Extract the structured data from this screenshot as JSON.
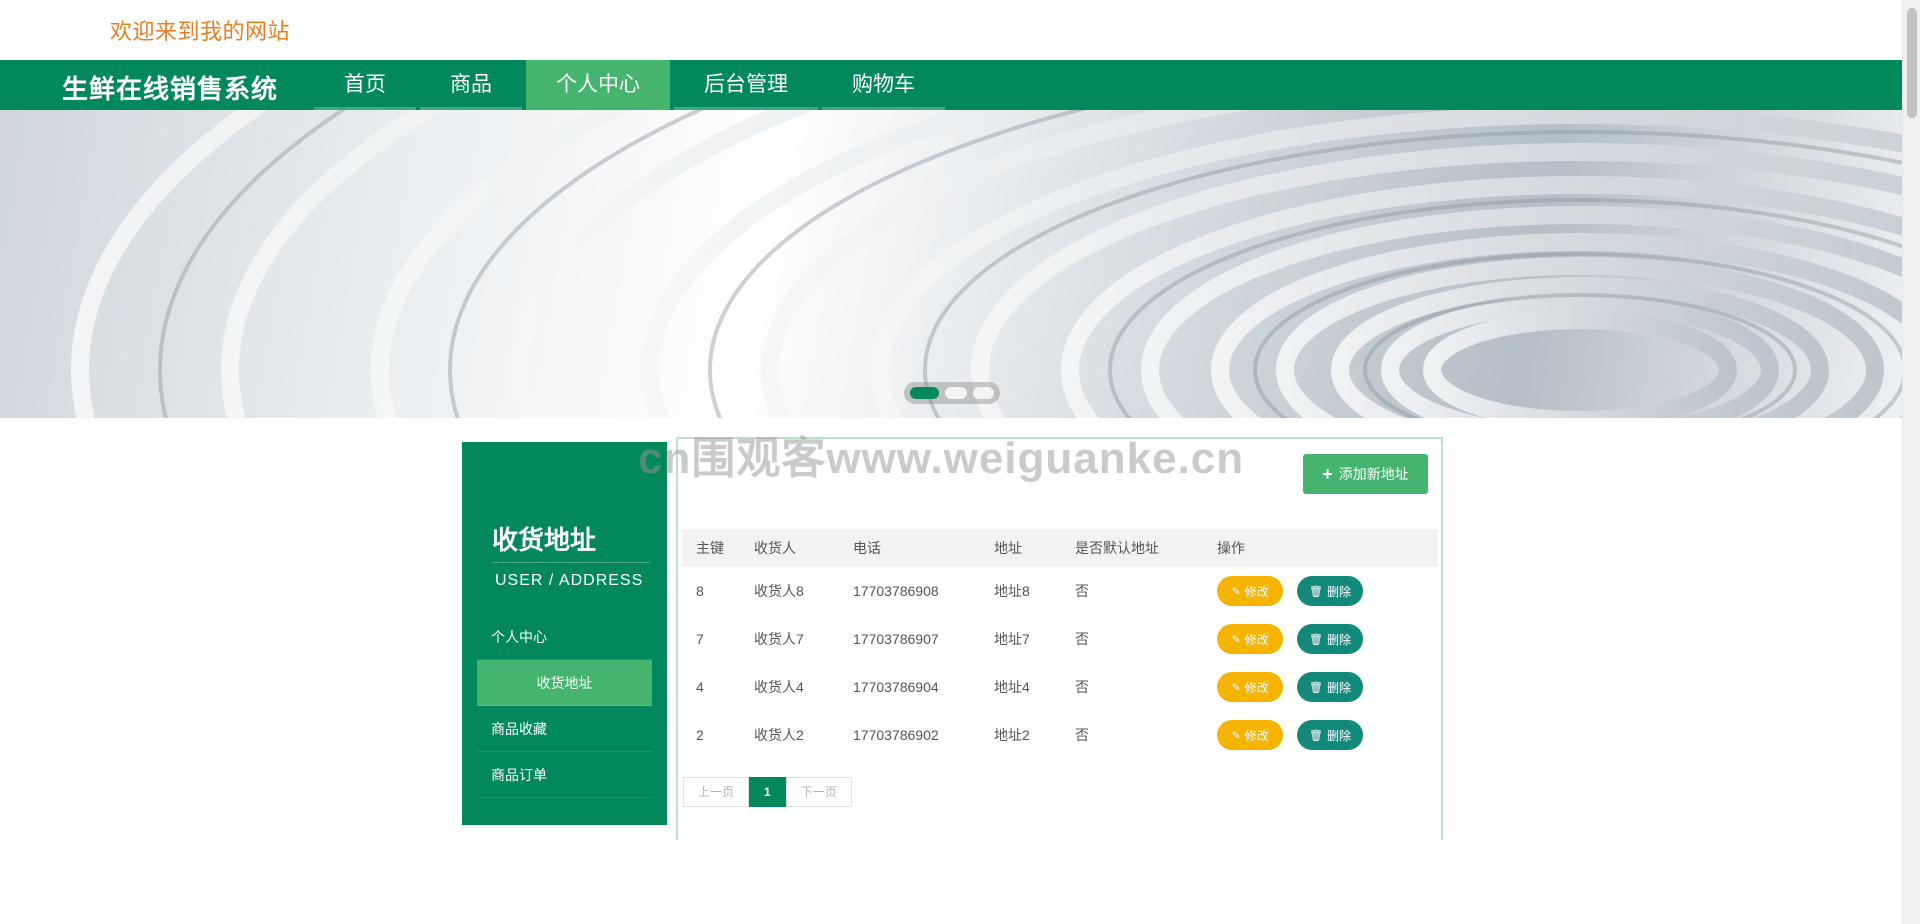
{
  "header": {
    "welcome": "欢迎来到我的网站"
  },
  "nav": {
    "brand": "生鲜在线销售系统",
    "items": [
      {
        "label": "首页",
        "active": false
      },
      {
        "label": "商品",
        "active": false
      },
      {
        "label": "个人中心",
        "active": true
      },
      {
        "label": "后台管理",
        "active": false
      },
      {
        "label": "购物车",
        "active": false
      }
    ]
  },
  "banner": {
    "slides": 3,
    "active_slide": 1
  },
  "watermark": "cn围观客www.weiguanke.cn",
  "sidebar": {
    "title": "收货地址",
    "subtitle": "USER / ADDRESS",
    "items": [
      {
        "label": "个人中心",
        "active": false
      },
      {
        "label": "收货地址",
        "active": true
      },
      {
        "label": "商品收藏",
        "active": false
      },
      {
        "label": "商品订单",
        "active": false
      }
    ]
  },
  "main": {
    "add_button": "添加新地址",
    "table": {
      "headers": [
        "主键",
        "收货人",
        "电话",
        "地址",
        "是否默认地址",
        "操作"
      ],
      "rows": [
        {
          "id": "8",
          "name": "收货人8",
          "phone": "17703786908",
          "address": "地址8",
          "default": "否"
        },
        {
          "id": "7",
          "name": "收货人7",
          "phone": "17703786907",
          "address": "地址7",
          "default": "否"
        },
        {
          "id": "4",
          "name": "收货人4",
          "phone": "17703786904",
          "address": "地址4",
          "default": "否"
        },
        {
          "id": "2",
          "name": "收货人2",
          "phone": "17703786902",
          "address": "地址2",
          "default": "否"
        }
      ],
      "edit_label": "修改",
      "delete_label": "删除"
    },
    "pagination": {
      "prev": "上一页",
      "current": "1",
      "next": "下一页"
    }
  },
  "colors": {
    "primary": "#03875d",
    "accent": "#45b46f",
    "edit": "#f5b400",
    "delete": "#13897a",
    "welcome": "#e67e22"
  }
}
